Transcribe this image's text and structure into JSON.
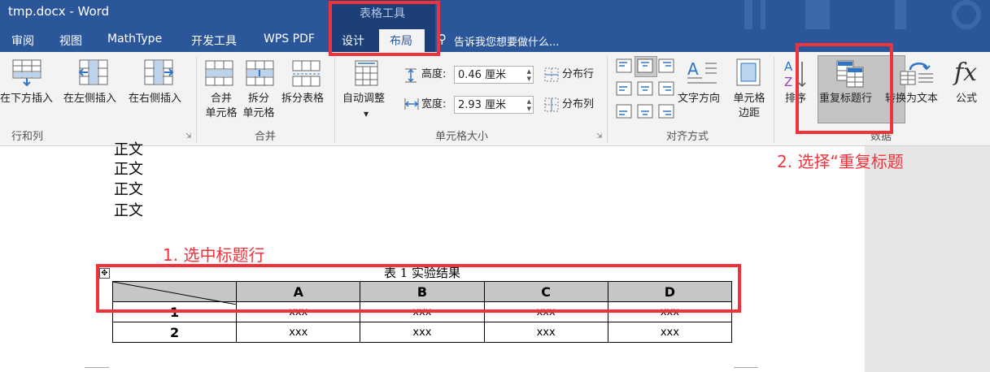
{
  "window": {
    "title": "tmp.docx - Word"
  },
  "contextual_group": {
    "label": "表格工具"
  },
  "tabs": [
    {
      "label": "审阅"
    },
    {
      "label": "视图"
    },
    {
      "label": "MathType"
    },
    {
      "label": "开发工具"
    },
    {
      "label": "WPS PDF"
    },
    {
      "label": "设计"
    },
    {
      "label": "布局"
    }
  ],
  "tell_me": {
    "text": "告诉我您想要做什么..."
  },
  "ribbon": {
    "rows_cols": {
      "insert_below": "在下方插入",
      "insert_left": "在左侧插入",
      "insert_right": "在右侧插入",
      "group_label": "行和列"
    },
    "merge": {
      "merge_cells_1": "合并",
      "merge_cells_2": "单元格",
      "split_cells_1": "拆分",
      "split_cells_2": "单元格",
      "split_table": "拆分表格",
      "group_label": "合并"
    },
    "cell_size": {
      "autofit": "自动调整",
      "height_label": "高度:",
      "height_value": "0.46 厘米",
      "width_label": "宽度:",
      "width_value": "2.93 厘米",
      "distribute_rows": "分布行",
      "distribute_cols": "分布列",
      "group_label": "单元格大小"
    },
    "alignment": {
      "text_direction": "文字方向",
      "cell_margins_1": "单元格",
      "cell_margins_2": "边距",
      "group_label": "对齐方式"
    },
    "data": {
      "sort": "排序",
      "repeat_header": "重复标题行",
      "convert_to_text": "转换为文本",
      "formula": "公式",
      "group_label": "数据"
    }
  },
  "document": {
    "body_lines": [
      "正文",
      "正文",
      "正文",
      "正文"
    ],
    "table_caption": "表 1 实验结果",
    "table": {
      "header": [
        "A",
        "B",
        "C",
        "D"
      ],
      "rows": [
        {
          "num": "1",
          "cells": [
            "xxx",
            "xxx",
            "xxx",
            "xxx"
          ]
        },
        {
          "num": "2",
          "cells": [
            "xxx",
            "xxx",
            "xxx",
            "xxx"
          ]
        }
      ]
    }
  },
  "annotations": {
    "step1": "1. 选中标题行",
    "step2": "2. 选择“重复标题"
  },
  "colors": {
    "title_bar": "#2b579a",
    "annotation_red": "#f2323a",
    "header_fill": "#c6c6c6"
  }
}
